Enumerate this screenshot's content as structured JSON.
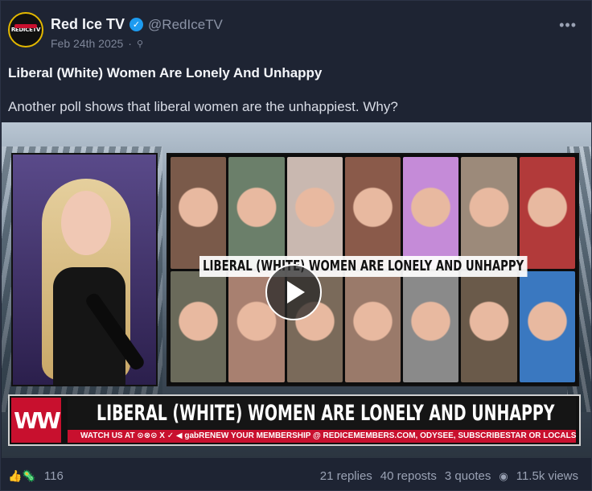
{
  "author": {
    "display_name": "Red Ice TV",
    "handle": "@RedIceTV",
    "date": "Feb 24th 2025",
    "avatar_text": "REDICETV"
  },
  "post": {
    "title": "Liberal (White) Women Are Lonely And Unhappy",
    "body": "Another poll shows that liberal women are the unhappiest. Why?"
  },
  "media": {
    "overlay_caption": "LIBERAL (WHITE) WOMEN ARE LONELY AND UNHAPPY",
    "logo_text": "WW",
    "banner_title": "LIBERAL (WHITE) WOMEN ARE LONELY AND UNHAPPY",
    "strip_left": "WATCH US AT ⊙⊗⊙ X ✓ ◀ gab",
    "strip_right": "RENEW YOUR MEMBERSHIP @ REDICEMEMBERS.COM, ODYSEE, SUBSCRIBESTAR OR LOCALS",
    "face_colors": [
      "#7a5a4a",
      "#6b7f6a",
      "#c9b8b0",
      "#8a5a4a",
      "#c58bd8",
      "#9c8a7a",
      "#b23a3a",
      "#6a6a5a",
      "#a88070",
      "#7a6a5a",
      "#9a7a6a",
      "#8a8a8a",
      "#6a5a4a",
      "#3a78c0"
    ]
  },
  "engagement": {
    "reaction_icons": "👍🦠",
    "likes": "116",
    "replies": "21 replies",
    "reposts": "40 reposts",
    "quotes": "3 quotes",
    "views": "11.5k views"
  },
  "icons": {
    "verified": "check-badge",
    "globe": "globe-icon",
    "more": "more-icon",
    "play": "play-icon",
    "eye": "eye-icon"
  }
}
